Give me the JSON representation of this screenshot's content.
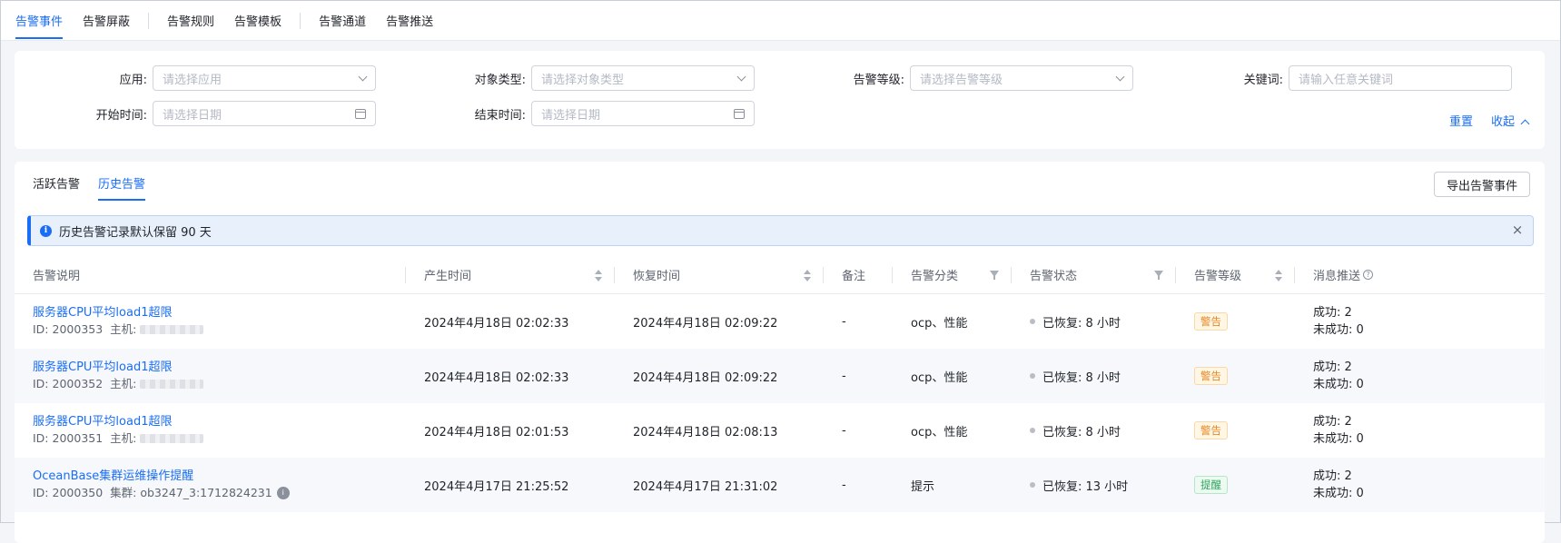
{
  "topnav": {
    "items": [
      "告警事件",
      "告警屏蔽",
      "告警规则",
      "告警模板",
      "告警通道",
      "告警推送"
    ]
  },
  "filter": {
    "app_label": "应用:",
    "app_placeholder": "请选择应用",
    "object_type_label": "对象类型:",
    "object_type_placeholder": "请选择对象类型",
    "level_label": "告警等级:",
    "level_placeholder": "请选择告警等级",
    "keyword_label": "关键词:",
    "keyword_placeholder": "请输入任意关键词",
    "start_label": "开始时间:",
    "start_placeholder": "请选择日期",
    "end_label": "结束时间:",
    "end_placeholder": "请选择日期",
    "reset": "重置",
    "collapse": "收起"
  },
  "tabs": [
    "活跃告警",
    "历史告警"
  ],
  "export_button": "导出告警事件",
  "notice": "历史告警记录默认保留 90 天",
  "columns": [
    "告警说明",
    "产生时间",
    "恢复时间",
    "备注",
    "告警分类",
    "告警状态",
    "告警等级",
    "消息推送"
  ],
  "rows": [
    {
      "title": "服务器CPU平均load1超限",
      "id_label": "ID:",
      "id": "2000353",
      "host_label": "主机:",
      "created": "2024年4月18日 02:02:33",
      "recovered": "2024年4月18日 02:09:22",
      "remark": "-",
      "category": "ocp、性能",
      "status": "已恢复: 8 小时",
      "level": "警告",
      "push_success": "成功:  2",
      "push_fail": "未成功: 0"
    },
    {
      "title": "服务器CPU平均load1超限",
      "id_label": "ID:",
      "id": "2000352",
      "host_label": "主机:",
      "created": "2024年4月18日 02:02:33",
      "recovered": "2024年4月18日 02:09:22",
      "remark": "-",
      "category": "ocp、性能",
      "status": "已恢复: 8 小时",
      "level": "警告",
      "push_success": "成功:  2",
      "push_fail": "未成功: 0"
    },
    {
      "title": "服务器CPU平均load1超限",
      "id_label": "ID:",
      "id": "2000351",
      "host_label": "主机:",
      "created": "2024年4月18日 02:01:53",
      "recovered": "2024年4月18日 02:08:13",
      "remark": "-",
      "category": "ocp、性能",
      "status": "已恢复: 8 小时",
      "level": "警告",
      "push_success": "成功:  2",
      "push_fail": "未成功: 0"
    },
    {
      "title": "OceanBase集群运维操作提醒",
      "id_label": "ID:",
      "id": "2000350",
      "host_label": "集群:",
      "cluster": "ob3247_3:1712824231",
      "created": "2024年4月17日 21:25:52",
      "recovered": "2024年4月17日 21:31:02",
      "remark": "-",
      "category": "提示",
      "status": "已恢复: 13 小时",
      "level": "提醒",
      "push_success": "成功:  2",
      "push_fail": "未成功: 0"
    }
  ],
  "colors": {
    "accent": "#1a6ef5",
    "warn": "#e8871e",
    "info": "#2ea35d"
  }
}
